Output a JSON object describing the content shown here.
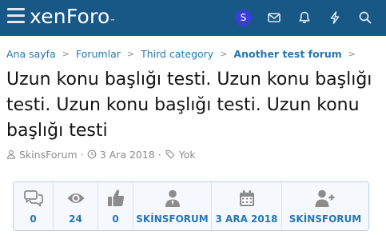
{
  "header": {
    "logo": "xenForo",
    "logo_mark": "™",
    "avatar_letter": "S",
    "icons": [
      "hamburger-icon",
      "envelope-icon",
      "bell-icon",
      "bolt-icon",
      "search-icon"
    ]
  },
  "breadcrumb": [
    "Ana sayfa",
    "Forumlar",
    "Third category",
    "Another test forum"
  ],
  "thread": {
    "title": "Uzun konu başlığı testi. Uzun konu başlığı testi. Uzun konu başlığı testi. Uzun konu başlığı testi",
    "author": "SkinsForum",
    "date": "3 Ara 2018",
    "tags": "Yok"
  },
  "stats": {
    "replies": "0",
    "views": "24",
    "likes": "0",
    "starter": "SKİNSFORUM",
    "first_date": "3 ARA 2018",
    "last_poster": "SKİNSFORUM"
  },
  "colors": {
    "header_bg": "#185886",
    "link": "#2577b1",
    "muted": "#8c8c8c",
    "avatar": "#3a3ed8"
  }
}
